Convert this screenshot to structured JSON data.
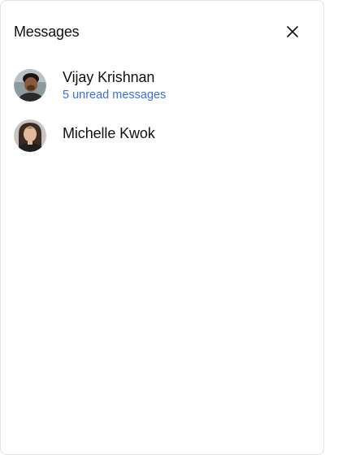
{
  "header": {
    "title": "Messages",
    "close_icon": "close-icon"
  },
  "conversations": [
    {
      "name": "Vijay Krishnan",
      "subtitle": "5 unread messages",
      "avatar_icon": "avatar-photo"
    },
    {
      "name": "Michelle Kwok",
      "subtitle": "",
      "avatar_icon": "avatar-photo"
    }
  ],
  "colors": {
    "unread_text": "#3b6fd6",
    "border": "#e3e3e3"
  }
}
